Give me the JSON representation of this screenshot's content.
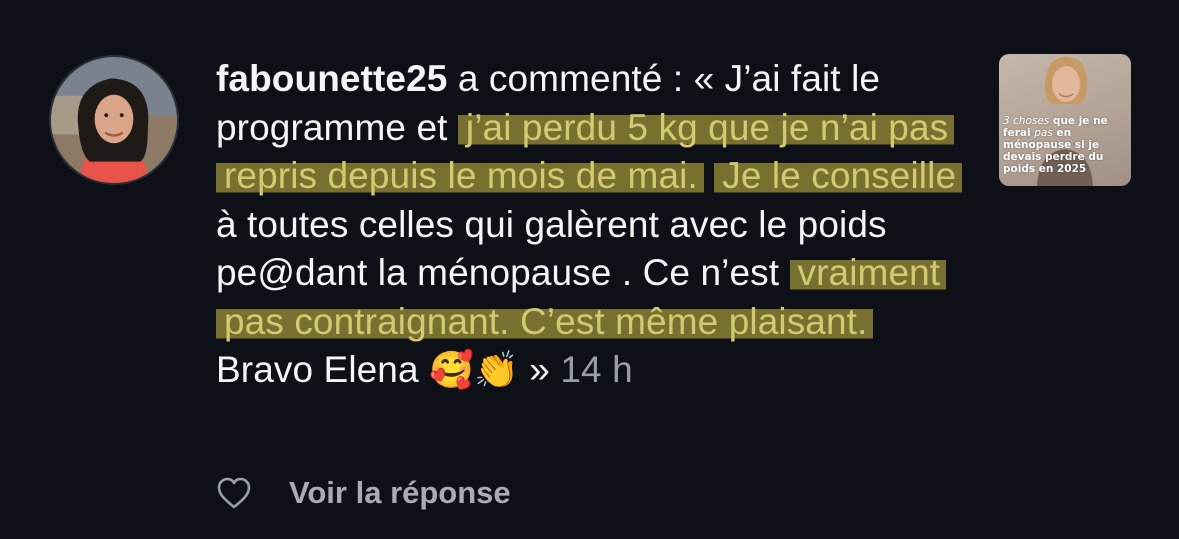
{
  "comment": {
    "username": "fabounette25",
    "lead": " a commenté : « J’ai fait le programme et ",
    "hl1": "j’ai perdu 5 kg que je n’ai pas repris depuis le mois de mai.",
    "gap1": " ",
    "hl2": "Je le conseille",
    "mid": " à toutes celles qui galèrent avec le poids pe@dant la ménopause . Ce n’est ",
    "hl3": "vraiment pas contraignant. C’est même plaisant.",
    "tail": " Bravo Elena ",
    "emoji1": "🥰",
    "emoji2": "👏",
    "close": " » ",
    "time": "14 h"
  },
  "thumbnail": {
    "prefix": "3 choses",
    "rest": " que je ne ferai ",
    "em": "pas",
    "rest2": " en ménopause si je devais perdre du poids en 2025"
  },
  "actions": {
    "like_icon": "heart-outline-icon",
    "reply_label": "Voir la réponse"
  },
  "colors": {
    "background": "#0d1117",
    "highlight": "#77702f",
    "highlight_text": "#d3c971",
    "muted": "#9a9ea5"
  }
}
